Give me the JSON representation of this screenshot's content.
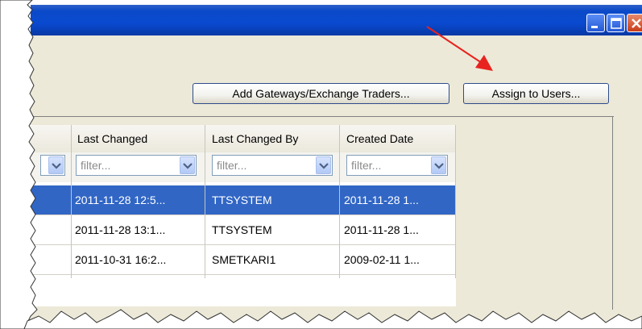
{
  "window": {
    "controls": [
      "minimize-icon",
      "maximize-icon",
      "close-icon"
    ]
  },
  "toolbar": {
    "add_gateways_label": "Add Gateways/Exchange Traders...",
    "assign_users_label": "Assign to Users..."
  },
  "grid": {
    "columns": [
      "Last Changed",
      "Last Changed By",
      "Created Date"
    ],
    "filter_placeholder": "filter...",
    "rows": [
      {
        "last_changed": "2011-11-28 12:5...",
        "last_changed_by": "TTSYSTEM",
        "created_date": "2011-11-28 1...",
        "selected": true
      },
      {
        "last_changed": "2011-11-28 13:1...",
        "last_changed_by": "TTSYSTEM",
        "created_date": "2011-11-28 1...",
        "selected": false
      },
      {
        "last_changed": "2011-10-31 16:2...",
        "last_changed_by": "SMETKARI1",
        "created_date": "2009-02-11 1...",
        "selected": false
      }
    ]
  },
  "colors": {
    "titlebar": "#0a49c8",
    "selection": "#3166c5",
    "annotation_arrow": "#e8231f",
    "window_background": "#ece9d8"
  }
}
